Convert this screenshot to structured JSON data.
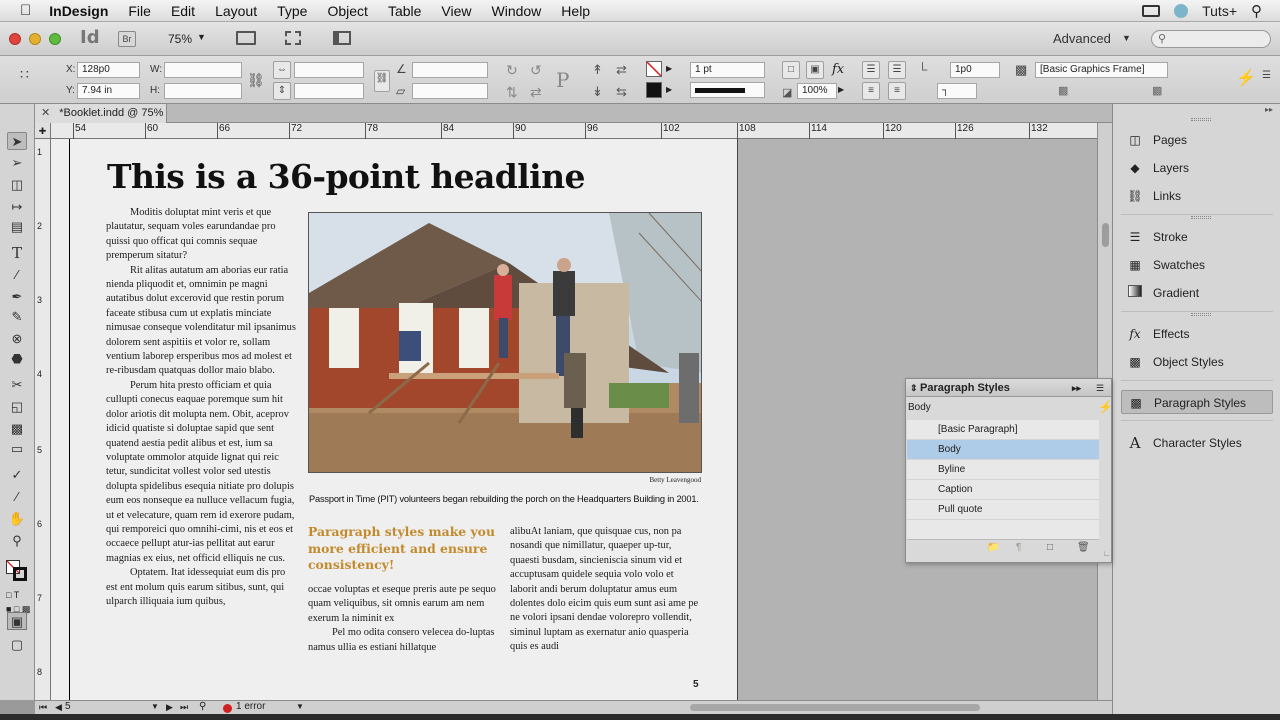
{
  "menubar": {
    "apple_icon": "apple-icon",
    "app_name": "InDesign",
    "items": [
      "File",
      "Edit",
      "Layout",
      "Type",
      "Object",
      "Table",
      "View",
      "Window",
      "Help"
    ],
    "right_app": "Tuts+"
  },
  "appbar": {
    "app_badge": "Id",
    "bridge_badge": "Br",
    "zoom": "75%",
    "workspace": "Advanced"
  },
  "control": {
    "x_label": "X:",
    "x_value": "128p0",
    "y_label": "Y:",
    "y_value": "7.94 in",
    "w_label": "W:",
    "h_label": "H:",
    "stroke_weight": "1 pt",
    "spacing_value": "1p0",
    "opacity": "100%",
    "object_style": "[Basic Graphics Frame]"
  },
  "document": {
    "tab_label": "*Booklet.indd @ 75%",
    "ruler_h": [
      "54",
      "60",
      "66",
      "72",
      "78",
      "84",
      "90",
      "96",
      "102",
      "108",
      "114",
      "120",
      "126",
      "132"
    ],
    "ruler_v": [
      "1",
      "2",
      "3",
      "4",
      "5",
      "6",
      "7",
      "8"
    ]
  },
  "page": {
    "headline": "This is a 36-point headline",
    "col1": [
      "Moditis doluptat mint veris et que plautatur, sequam voles earundandae pro quissi quo officat qui comnis sequae premperum sitatur?",
      "Rit alitas autatum am aborias eur ratia nienda pliquodit et, omnimin pe magni autatibus dolut excerovid que restin porum faceate stibusa cum ut explatis minciate nimusae conseque volenditatur mil ipsanimus dolorem sent aspitiis et volor re, sollam ventium laborep ersperibus mos ad molest et re-ribusdam quatquas dollor maio blabo.",
      "Perum hita presto officiam et quia cullupti conecus eaquae poremque sum hit dolor ariotis dit molupta nem. Obit, aceprov idicid quatiste si doluptae sapid que sent quatend aestia pedit alibus et est, ium sa voluptate ommolor atquide lignat qui reic tetur, sundicitat vollest volor sed utestis dolupta spidelibus esequia nitiate pro dolupis eum eos nonseque ea nulluce vellacum fugia, ut et velecature, quam rem id exerore pudam, qui remporeici quo omnihi-cimi, nis et eos et occaece pellupt atur-ias pellitat aut earur magnias ex eius, net officid elliquis ne cus.",
      "Optatem. Itat idessequiat eum dis pro est ent molum quis earum sitibus, sunt, qui ulparch illiquaia ium quibus,"
    ],
    "photo_credit": "Betty Leavengood",
    "caption": "Passport in Time (PIT) volunteers began rebuilding the porch on the Headquarters Building in 2001.",
    "pullquote": "Paragraph styles make you more efficient and ensure consistency!",
    "col2": [
      "occae voluptas et eseque preris aute pe sequo quam veliquibus, sit omnis earum am nem exerum la niminit ex",
      "Pel mo odita consero velecea do-luptas namus ullia es estiani hillatque"
    ],
    "col3": "alibuAt laniam, que quisquae cus, non pa nosandi que nimillatur, quaeper up-tur, quaesti busdam, sincieniscia sinum vid et accuptusam quidele sequia volo volo et laborit andi berum doluptatur amus eum dolentes dolo eicim quis eum sunt asi ame pe ne volori ipsani dendae volorepro vollendit, siminul luptam as exernatur anio quasperia quis es audi",
    "page_number": "5"
  },
  "statusbar": {
    "page_field": "5",
    "error_text": "1 error"
  },
  "dock": {
    "items": [
      {
        "label": "Pages",
        "icon": "pages-icon"
      },
      {
        "label": "Layers",
        "icon": "layers-icon"
      },
      {
        "label": "Links",
        "icon": "links-icon"
      },
      {
        "label": "Stroke",
        "icon": "stroke-icon"
      },
      {
        "label": "Swatches",
        "icon": "swatches-icon"
      },
      {
        "label": "Gradient",
        "icon": "gradient-icon"
      },
      {
        "label": "Effects",
        "icon": "fx-icon"
      },
      {
        "label": "Object Styles",
        "icon": "object-styles-icon"
      },
      {
        "label": "Paragraph Styles",
        "icon": "paragraph-styles-icon"
      },
      {
        "label": "Character Styles",
        "icon": "character-styles-icon"
      }
    ]
  },
  "paragraph_styles_panel": {
    "title": "Paragraph Styles",
    "current": "Body",
    "styles": [
      "[Basic Paragraph]",
      "Body",
      "Byline",
      "Caption",
      "Pull quote"
    ],
    "selected": "Body"
  },
  "colors": {
    "pullquote": "#c38a2c",
    "selection": "#aecbe8",
    "error_dot": "#d02020"
  }
}
